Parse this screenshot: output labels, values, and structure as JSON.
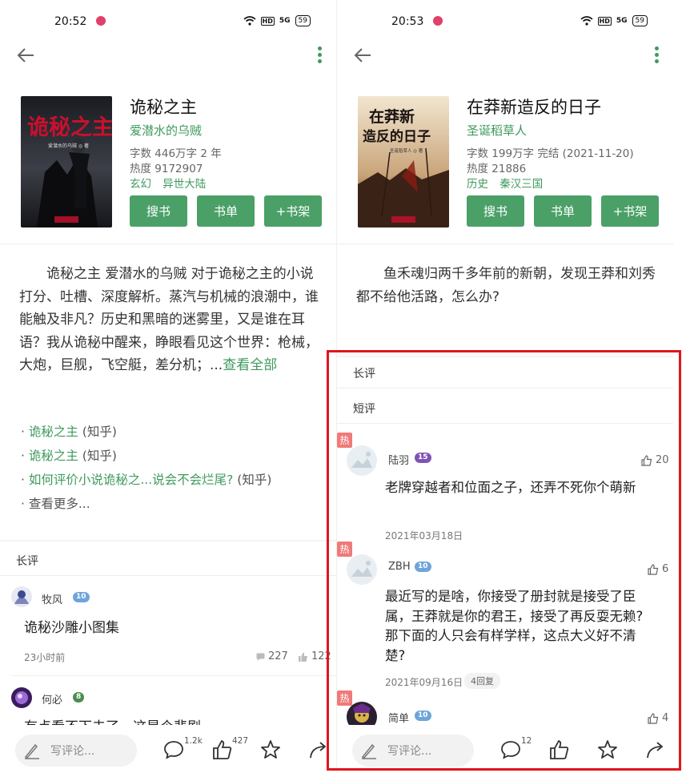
{
  "left": {
    "status": {
      "time": "20:52",
      "hd": "HD",
      "signal": "5G",
      "battery": "59"
    },
    "book": {
      "title": "诡秘之主",
      "author": "爱潜水的乌贼",
      "words": "字数 446万字  2 年",
      "heat": "热度 9172907",
      "tags": [
        "玄幻",
        "异世大陆"
      ],
      "cover_title": "诡秘之主",
      "cover_author": "爱潜水的乌贼 ◎ 著"
    },
    "buttons": {
      "search": "搜书",
      "list": "书单",
      "shelf": "+书架"
    },
    "intro": {
      "text": "诡秘之主 爱潜水的乌贼 对于诡秘之主的小说打分、吐槽、深度解析。蒸汽与机械的浪潮中，谁能触及非凡？历史和黑暗的迷雾里，又是谁在耳语？我从诡秘中醒来，睁眼看见这个世界：枪械，大炮，巨舰，飞空艇，差分机；...",
      "link": "查看全部"
    },
    "refs": [
      {
        "dot": "· ",
        "link": "诡秘之主",
        "src": " (知乎)"
      },
      {
        "dot": "· ",
        "link": "诡秘之主",
        "src": " (知乎)"
      },
      {
        "dot": "· ",
        "link": "如何评价小说诡秘之...说会不会烂尾?",
        "src": " (知乎)"
      },
      {
        "dot": "· ",
        "link": "",
        "src": "查看更多..."
      }
    ],
    "long_review_label": "长评",
    "reviews": [
      {
        "user": "牧风",
        "level": "10",
        "text": "诡秘沙雕小图集",
        "time": "23小时前",
        "comments": "227",
        "likes": "122"
      },
      {
        "user": "何必",
        "level": "8",
        "text": "有点看不下去了，这是个悲剧"
      }
    ],
    "bottom": {
      "placeholder": "写评论...",
      "comments": "1.2k",
      "likes": "427"
    }
  },
  "right": {
    "status": {
      "time": "20:53",
      "hd": "HD",
      "signal": "5G",
      "battery": "59"
    },
    "book": {
      "title": "在莽新造反的日子",
      "author": "圣诞稻草人",
      "words": "字数 199万字  完结 (2021-11-20)",
      "heat": "热度 21886",
      "tags": [
        "历史",
        "秦汉三国"
      ],
      "cover_title_1": "在莽新",
      "cover_title_2": "造反的日子",
      "cover_author": "圣诞稻草人 ◎ 著"
    },
    "buttons": {
      "search": "搜书",
      "list": "书单",
      "shelf": "+书架"
    },
    "intro": {
      "text": "鱼禾魂归两千多年前的新朝，发现王莽和刘秀都不给他活路，怎么办?"
    },
    "long_review_label": "长评",
    "short_review_label": "短评",
    "hot_label": "热",
    "reviews": [
      {
        "user": "陆羽",
        "level": "15",
        "likes": "20",
        "text": "老牌穿越者和位面之子，还弄不死你个萌新",
        "date": "2021年03月18日"
      },
      {
        "user": "ZBH",
        "level": "10",
        "likes": "6",
        "text": "最近写的是啥，你接受了册封就是接受了臣属，王莽就是你的君王，接受了再反耍无赖? 那下面的人只会有样学样，这点大义好不清楚?",
        "date": "2021年09月16日",
        "replies": "4回复"
      },
      {
        "user": "简单",
        "level": "10",
        "likes": "4"
      }
    ],
    "bottom": {
      "placeholder": "写评论...",
      "comments": "12"
    }
  },
  "colors": {
    "accent": "#3f9a5d",
    "button": "#4ba068",
    "hot": "#f07a7a",
    "highlight": "#e0161d"
  },
  "icons": [
    "back-arrow-icon",
    "more-vert-icon",
    "wifi-icon",
    "pencil-icon",
    "comment-icon",
    "thumb-up-icon",
    "star-icon",
    "share-icon",
    "fire-icon"
  ]
}
